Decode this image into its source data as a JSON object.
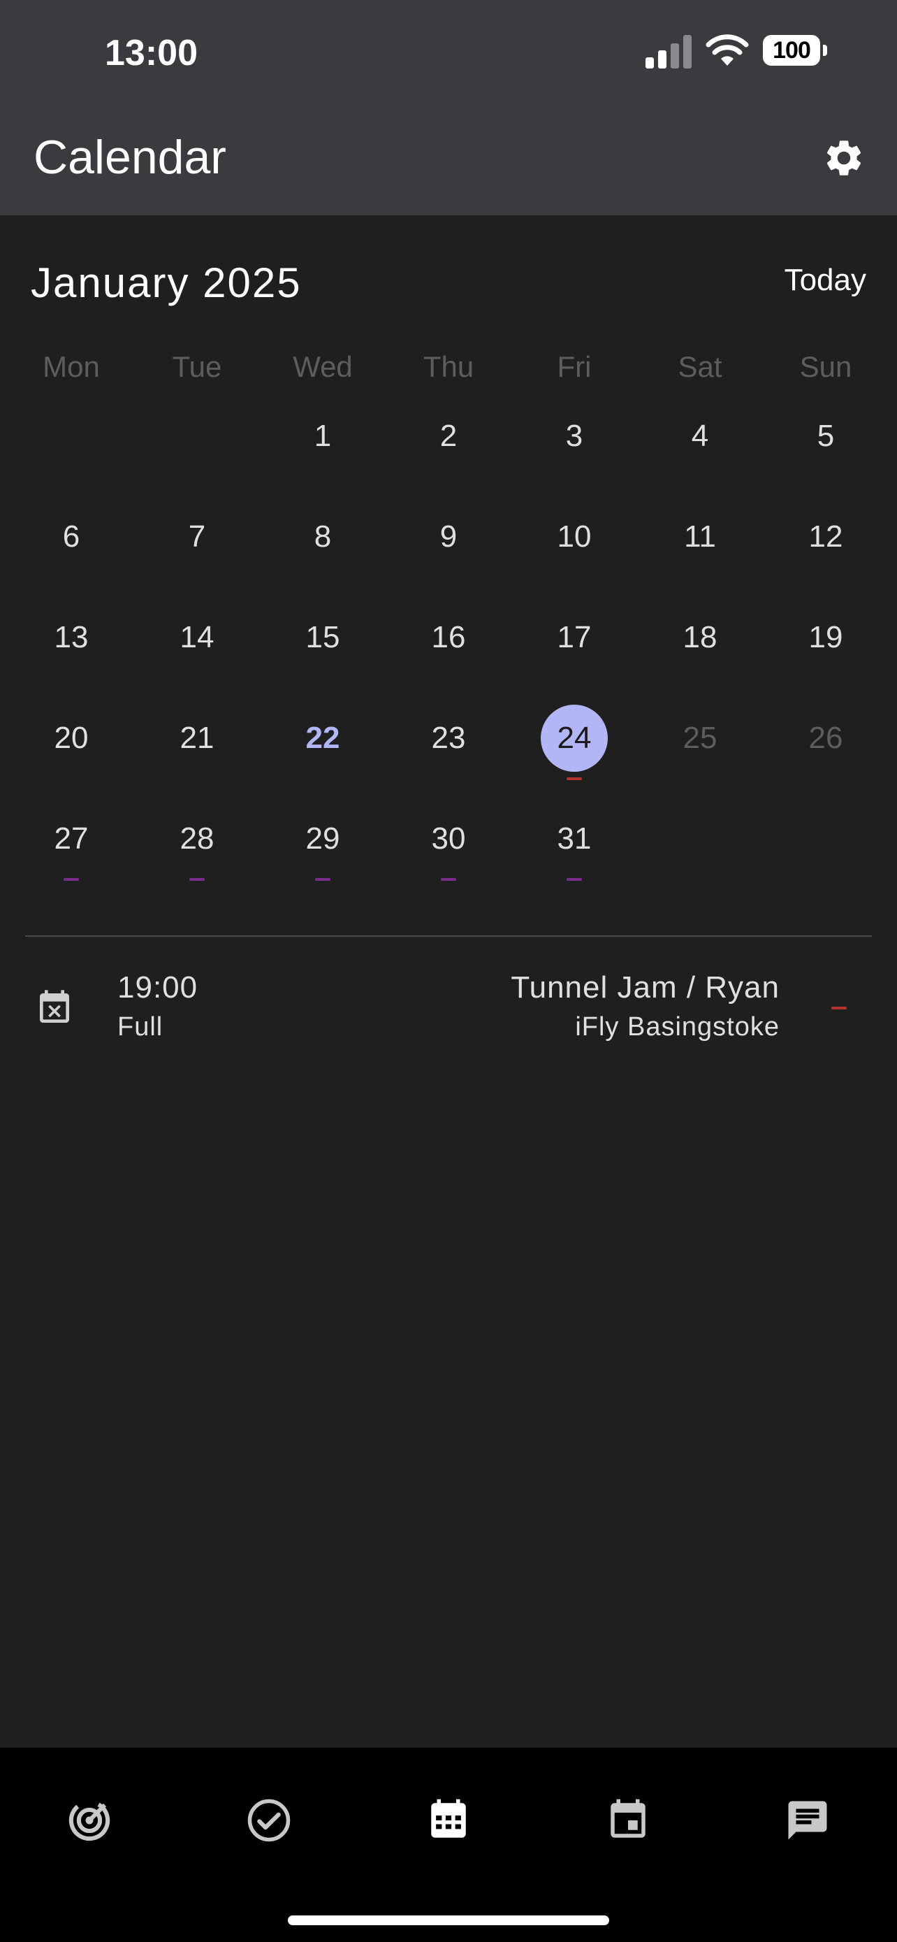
{
  "status_bar": {
    "time": "13:00",
    "battery": "100"
  },
  "app_bar": {
    "title": "Calendar",
    "settings_icon": "gear-icon"
  },
  "calendar": {
    "month_label": "January 2025",
    "today_label": "Today",
    "weekdays": [
      "Mon",
      "Tue",
      "Wed",
      "Thu",
      "Fri",
      "Sat",
      "Sun"
    ],
    "current_day": "22",
    "selected_day": "24",
    "weeks": [
      [
        {
          "n": ""
        },
        {
          "n": ""
        },
        {
          "n": "1"
        },
        {
          "n": "2"
        },
        {
          "n": "3"
        },
        {
          "n": "4"
        },
        {
          "n": "5"
        }
      ],
      [
        {
          "n": "6"
        },
        {
          "n": "7"
        },
        {
          "n": "8"
        },
        {
          "n": "9"
        },
        {
          "n": "10"
        },
        {
          "n": "11"
        },
        {
          "n": "12"
        }
      ],
      [
        {
          "n": "13"
        },
        {
          "n": "14"
        },
        {
          "n": "15"
        },
        {
          "n": "16"
        },
        {
          "n": "17"
        },
        {
          "n": "18"
        },
        {
          "n": "19"
        }
      ],
      [
        {
          "n": "20"
        },
        {
          "n": "21"
        },
        {
          "n": "22",
          "state": "current"
        },
        {
          "n": "23"
        },
        {
          "n": "24",
          "state": "selected",
          "event_color": "#b5322e"
        },
        {
          "n": "25",
          "state": "muted"
        },
        {
          "n": "26",
          "state": "muted"
        }
      ],
      [
        {
          "n": "27",
          "event_color": "#7a2d8c"
        },
        {
          "n": "28",
          "event_color": "#7a2d8c"
        },
        {
          "n": "29",
          "event_color": "#7a2d8c"
        },
        {
          "n": "30",
          "event_color": "#7a2d8c"
        },
        {
          "n": "31",
          "event_color": "#7a2d8c"
        },
        {
          "n": ""
        },
        {
          "n": ""
        }
      ]
    ]
  },
  "event": {
    "icon": "calendar-remove-icon",
    "time": "19:00",
    "status": "Full",
    "title": "Tunnel Jam / Ryan",
    "location": "iFly Basingstoke",
    "indicator_color": "#b5322e"
  },
  "bottom_nav": [
    {
      "icon": "radar-icon"
    },
    {
      "icon": "check-circle-icon"
    },
    {
      "icon": "calendar-month-icon",
      "active": true
    },
    {
      "icon": "calendar-event-icon"
    },
    {
      "icon": "message-icon"
    }
  ]
}
